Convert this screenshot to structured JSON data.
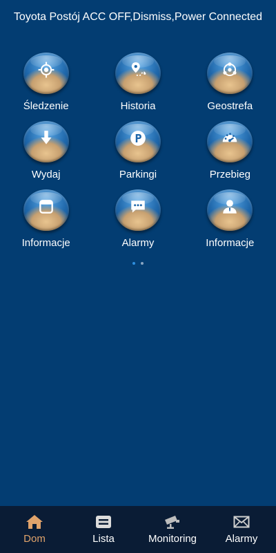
{
  "header": {
    "title": "Toyota Postój ACC OFF,Dismiss,Power Connected"
  },
  "tiles": [
    {
      "label": "Śledzenie",
      "icon": "crosshair-icon"
    },
    {
      "label": "Historia",
      "icon": "route-pin-icon"
    },
    {
      "label": "Geostrefa",
      "icon": "geofence-icon"
    },
    {
      "label": "Wydaj",
      "icon": "download-arrow-icon"
    },
    {
      "label": "Parkingi",
      "icon": "parking-icon"
    },
    {
      "label": "Przebieg",
      "icon": "speedometer-icon"
    },
    {
      "label": "Informacje",
      "icon": "calendar-icon"
    },
    {
      "label": "Alarmy",
      "icon": "message-bubble-icon"
    },
    {
      "label": "Informacje",
      "icon": "user-icon"
    }
  ],
  "pager": {
    "pages": 2,
    "current": 1
  },
  "nav": [
    {
      "label": "Dom",
      "icon": "home-icon",
      "active": true
    },
    {
      "label": "Lista",
      "icon": "list-icon",
      "active": false
    },
    {
      "label": "Monitoring",
      "icon": "camera-icon",
      "active": false
    },
    {
      "label": "Alarmy",
      "icon": "envelope-icon",
      "active": false
    }
  ],
  "colors": {
    "background": "#033d72",
    "nav_background": "#0a1c35",
    "nav_active": "#e0a36b",
    "pager_active": "#2d8fe0"
  }
}
